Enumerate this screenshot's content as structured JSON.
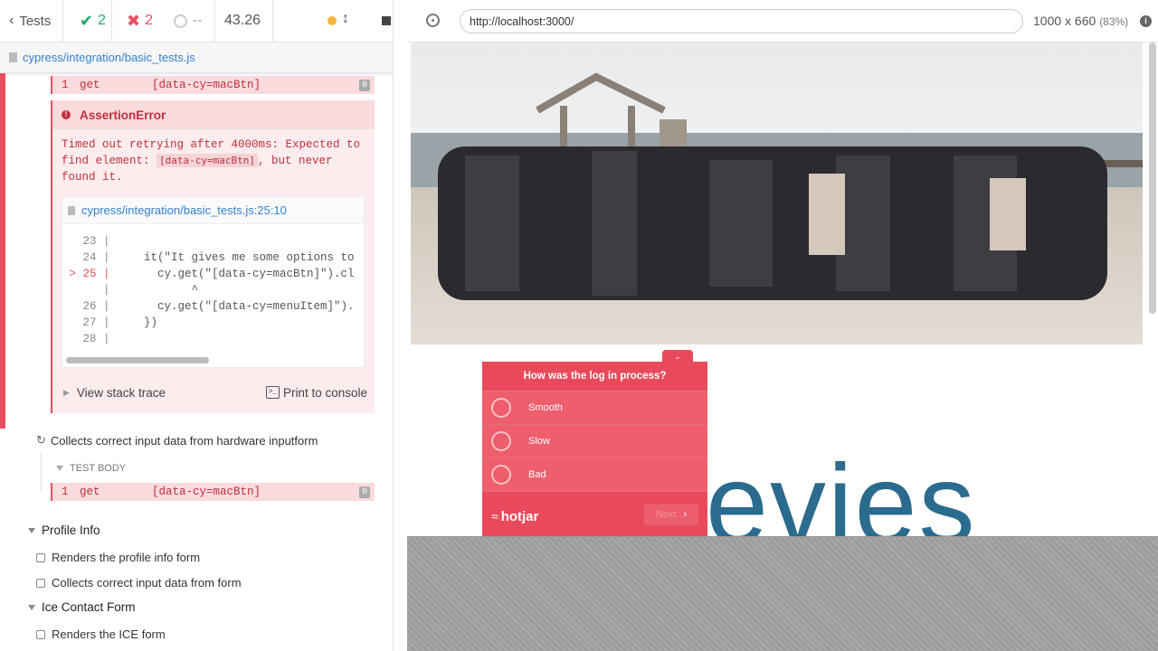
{
  "topbar": {
    "back_label": "Tests",
    "passed": "2",
    "failed": "2",
    "pending": "--",
    "duration": "43.26"
  },
  "spec": {
    "file": "cypress/integration/basic_tests.js"
  },
  "commands": {
    "first": {
      "num": "1",
      "name": "get",
      "selector": "[data-cy=macBtn]",
      "badge": "0"
    },
    "second": {
      "num": "1",
      "name": "get",
      "selector": "[data-cy=macBtn]",
      "badge": "0"
    }
  },
  "error": {
    "title": "AssertionError",
    "msg_part1": "Timed out retrying after 4000ms: Expected to find element: ",
    "msg_code": "[data-cy=macBtn]",
    "msg_part2": ", but never found it.",
    "file_link": "cypress/integration/basic_tests.js:25:10",
    "code_lines": [
      {
        "ln": "23",
        "marker": "",
        "code": ""
      },
      {
        "ln": "24",
        "marker": "",
        "code": "    it(\"It gives me some options to"
      },
      {
        "ln": "25",
        "marker": ">",
        "code": "      cy.get(\"[data-cy=macBtn]\").cl"
      },
      {
        "ln": "",
        "marker": "",
        "code": "           ^"
      },
      {
        "ln": "26",
        "marker": "",
        "code": "      cy.get(\"[data-cy=menuItem]\")."
      },
      {
        "ln": "27",
        "marker": "",
        "code": "    })"
      },
      {
        "ln": "28",
        "marker": "",
        "code": ""
      }
    ],
    "stack_label": "View stack trace",
    "console_label": "Print to console"
  },
  "tests": {
    "collects_hw": "Collects correct input data from hardware inputform",
    "test_body": "TEST BODY",
    "profile_suite": "Profile Info",
    "profile_t1": "Renders the profile info form",
    "profile_t2": "Collects correct input data from form",
    "ice_suite": "Ice Contact Form",
    "ice_t1": "Renders the ICE form"
  },
  "browser": {
    "url": "http://localhost:3000/",
    "size": "1000 x 660",
    "scale": "(83%)"
  },
  "survey": {
    "question": "How was the log in process?",
    "options": [
      "Smooth",
      "Slow",
      "Bad"
    ],
    "brand": "hotjar",
    "next": "Next"
  },
  "page": {
    "logo_fragment": "evies"
  },
  "colors": {
    "fail": "#e94f5f",
    "pass": "#1fa971",
    "link": "#3380d3",
    "hotjar": "#e84a5b"
  }
}
